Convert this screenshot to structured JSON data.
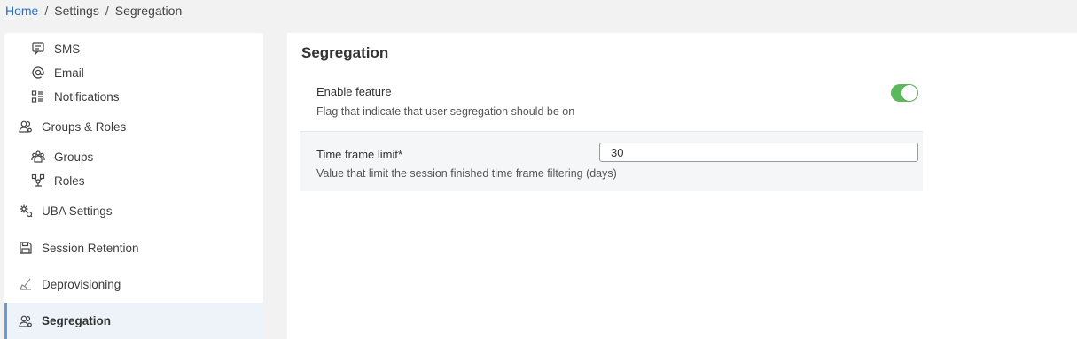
{
  "breadcrumb": {
    "home": "Home",
    "sep": "/",
    "settings": "Settings",
    "current": "Segregation"
  },
  "sidebar": {
    "items": [
      {
        "label": "SMS",
        "icon": "sms-icon"
      },
      {
        "label": "Email",
        "icon": "at-sign-icon"
      },
      {
        "label": "Notifications",
        "icon": "list-icon"
      },
      {
        "label": "Groups & Roles",
        "icon": "users-icon"
      },
      {
        "label": "Groups",
        "icon": "group-icon"
      },
      {
        "label": "Roles",
        "icon": "roles-icon"
      },
      {
        "label": "UBA Settings",
        "icon": "uba-icon"
      },
      {
        "label": "Session Retention",
        "icon": "save-icon"
      },
      {
        "label": "Deprovisioning",
        "icon": "deprovision-icon"
      },
      {
        "label": "Segregation",
        "icon": "users-icon"
      }
    ]
  },
  "content": {
    "title": "Segregation",
    "enable": {
      "label": "Enable feature",
      "description": "Flag that indicate that user segregation should be on",
      "enabled": true,
      "toggle_color": "#5cb85c"
    },
    "timeframe": {
      "label": "Time frame limit*",
      "value": "30",
      "description": "Value that limit the session finished time frame filtering (days)"
    }
  }
}
